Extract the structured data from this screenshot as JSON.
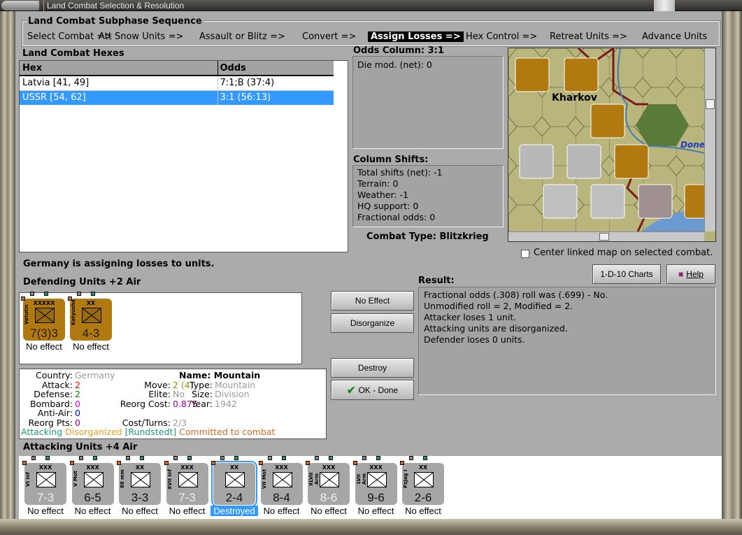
{
  "window": {
    "title": "Land Combat Selection & Resolution"
  },
  "subphase": {
    "title": "Land Combat Subphase Sequence",
    "steps": [
      "Select Combat =>",
      "Att Snow Units =>",
      "Assault or Blitz =>",
      "Convert =>",
      "Assign Losses =>",
      "Hex Control =>",
      "Retreat Units =>",
      "Advance Units"
    ],
    "active_index": 4
  },
  "hexes": {
    "title": "Land Combat Hexes",
    "columns": [
      "Hex",
      "Odds"
    ],
    "rows": [
      {
        "hex": "Latvia [41, 49]",
        "odds": "7:1;B (37:4)"
      },
      {
        "hex": "USSR [54, 62]",
        "odds": "3:1 (56:13)"
      }
    ],
    "selected_index": 1
  },
  "odds": {
    "title": "Odds Column: 3:1",
    "lines": [
      "Die mod. (net): 0"
    ]
  },
  "shifts": {
    "title": "Column Shifts:",
    "lines": [
      "Total shifts (net): -1",
      "Terrain: 0",
      "Weather: -1",
      "HQ support: 0",
      "Fractional odds: 0"
    ]
  },
  "combat_type": "Combat Type:  Blitzkrieg",
  "map": {
    "labels": [
      "Kharkov",
      "Done"
    ],
    "center_linked_label": "Center linked map on selected combat.",
    "center_linked_checked": false
  },
  "buttons": {
    "charts": "1-D-10 Charts",
    "help": "Help",
    "no_effect": "No Effect",
    "disorganize": "Disorganize",
    "destroy": "Destroy",
    "ok": "OK - Done"
  },
  "status": "Germany is assigning losses to units.",
  "defending": {
    "title": "Defending Units +2 Air",
    "units": [
      {
        "name": "Vatutin",
        "size": "XXXXX",
        "value": "7(3)3",
        "result": "No effect",
        "color": "#b07a10"
      },
      {
        "name": "Katyusha",
        "size": "XX",
        "value": "4-3",
        "result": "No effect",
        "color": "#b07a10"
      }
    ]
  },
  "result": {
    "title": "Result:",
    "lines": [
      "Fractional odds (.308) roll was (.699)  - No.",
      "Unmodified roll = 2, Modified = 2.",
      "Attacker loses 1 unit.",
      "Attacking units are disorganized.",
      "Defender loses 0 units."
    ]
  },
  "info": {
    "country_label": "Country:",
    "country": "Germany",
    "attack_label": "Attack:",
    "attack": "2",
    "defense_label": "Defense:",
    "defense": "2",
    "bombard_label": "Bombard:",
    "bombard": "0",
    "antiair_label": "Anti-Air:",
    "antiair": "0",
    "reorgpts_label": "Reorg Pts:",
    "reorgpts": "0",
    "name": "Name: Mountain",
    "move_label": "Move:",
    "move": "2 (4)",
    "elite_label": "Elite:",
    "elite": "No",
    "reorgcost_label": "Reorg Cost:",
    "reorgcost": "0.875",
    "costturns_label": "Cost/Turns:",
    "costturns": "2/3",
    "type_label": "Type:",
    "type": "Mountain",
    "size_label": "Size:",
    "size": "Division",
    "year_label": "Year:",
    "year": "1942",
    "status_attacking": "Attacking",
    "status_disorg": "Disorganized",
    "status_hq": "[Rundstedt]",
    "status_committed": "Committed to combat"
  },
  "attacking": {
    "title": "Attacking Units +4 Air",
    "units": [
      {
        "name": "VI Inf",
        "size": "XXX",
        "value": "7-3",
        "result": "No effect"
      },
      {
        "name": "V Mot",
        "size": "XXX",
        "value": "6-5",
        "result": "No effect"
      },
      {
        "name": "88 mm",
        "size": "XX",
        "value": "3-3",
        "result": "No effect"
      },
      {
        "name": "XVII Inf",
        "size": "XXX",
        "value": "7-3",
        "result": "No effect"
      },
      {
        "name": "",
        "size": "XX",
        "value": "2-4",
        "result": "Destroyed",
        "selected": true
      },
      {
        "name": "VII Mot",
        "size": "XXX",
        "value": "8-4",
        "result": "No effect"
      },
      {
        "name": "XLVII Arm",
        "size": "XXX",
        "value": "8-6",
        "result": "No effect"
      },
      {
        "name": "LVII Arm",
        "size": "XXX",
        "value": "9-6",
        "result": "No effect"
      },
      {
        "name": "PzJag I",
        "size": "XX",
        "value": "2-6",
        "result": "No effect"
      }
    ]
  },
  "colors": {
    "selection": "#3399ff",
    "german_counter": "#a6a6a6",
    "soviet_counter": "#b07a10"
  }
}
